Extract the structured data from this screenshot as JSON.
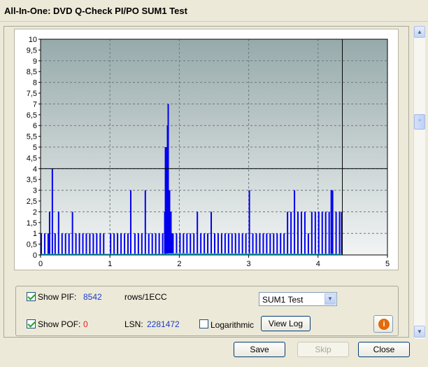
{
  "window": {
    "title": "All-In-One: DVD Q-Check PI/PO SUM1 Test"
  },
  "chart_data": {
    "type": "bar",
    "xlabel": "",
    "ylabel": "",
    "xlim": [
      0,
      5
    ],
    "ylim": [
      0,
      10
    ],
    "x_ticks": [
      "0",
      "1",
      "2",
      "3",
      "4",
      "5"
    ],
    "y_ticks": [
      "0",
      "0,5",
      "1",
      "1,5",
      "2",
      "2,5",
      "3",
      "3,5",
      "4",
      "4,5",
      "5",
      "5,5",
      "6",
      "6,5",
      "7",
      "7,5",
      "8",
      "8,5",
      "9",
      "9,5",
      "10"
    ],
    "threshold_y": 4,
    "end_marker_x": 4.35,
    "colors": {
      "pif": "#0000ee",
      "pof": "#00c8d8",
      "threshold": "#000000"
    },
    "series": [
      {
        "name": "PIF",
        "points": [
          [
            0.0,
            1
          ],
          [
            0.05,
            1
          ],
          [
            0.1,
            1
          ],
          [
            0.12,
            2
          ],
          [
            0.16,
            4
          ],
          [
            0.2,
            1
          ],
          [
            0.25,
            2
          ],
          [
            0.3,
            1
          ],
          [
            0.35,
            1
          ],
          [
            0.4,
            1
          ],
          [
            0.45,
            2
          ],
          [
            0.5,
            1
          ],
          [
            0.55,
            1
          ],
          [
            0.6,
            1
          ],
          [
            0.65,
            1
          ],
          [
            0.7,
            1
          ],
          [
            0.75,
            1
          ],
          [
            0.8,
            1
          ],
          [
            0.85,
            1
          ],
          [
            0.9,
            1
          ],
          [
            1.0,
            1
          ],
          [
            1.05,
            1
          ],
          [
            1.1,
            1
          ],
          [
            1.15,
            1
          ],
          [
            1.2,
            1
          ],
          [
            1.25,
            1
          ],
          [
            1.29,
            3
          ],
          [
            1.35,
            1
          ],
          [
            1.4,
            1
          ],
          [
            1.45,
            1
          ],
          [
            1.5,
            3
          ],
          [
            1.55,
            1
          ],
          [
            1.6,
            1
          ],
          [
            1.65,
            1
          ],
          [
            1.7,
            1
          ],
          [
            1.75,
            1
          ],
          [
            1.78,
            2
          ],
          [
            1.79,
            5
          ],
          [
            1.8,
            5
          ],
          [
            1.81,
            4
          ],
          [
            1.82,
            6
          ],
          [
            1.83,
            7
          ],
          [
            1.84,
            3
          ],
          [
            1.85,
            3
          ],
          [
            1.86,
            2
          ],
          [
            1.87,
            2
          ],
          [
            1.88,
            1
          ],
          [
            1.9,
            1
          ],
          [
            1.95,
            1
          ],
          [
            2.0,
            1
          ],
          [
            2.05,
            1
          ],
          [
            2.1,
            1
          ],
          [
            2.15,
            1
          ],
          [
            2.2,
            1
          ],
          [
            2.25,
            2
          ],
          [
            2.3,
            1
          ],
          [
            2.35,
            1
          ],
          [
            2.4,
            1
          ],
          [
            2.45,
            2
          ],
          [
            2.5,
            1
          ],
          [
            2.55,
            1
          ],
          [
            2.6,
            1
          ],
          [
            2.65,
            1
          ],
          [
            2.7,
            1
          ],
          [
            2.75,
            1
          ],
          [
            2.8,
            1
          ],
          [
            2.85,
            1
          ],
          [
            2.9,
            1
          ],
          [
            2.95,
            1
          ],
          [
            3.0,
            3
          ],
          [
            3.05,
            1
          ],
          [
            3.1,
            1
          ],
          [
            3.15,
            1
          ],
          [
            3.2,
            1
          ],
          [
            3.25,
            1
          ],
          [
            3.3,
            1
          ],
          [
            3.35,
            1
          ],
          [
            3.4,
            1
          ],
          [
            3.45,
            1
          ],
          [
            3.5,
            1
          ],
          [
            3.55,
            2
          ],
          [
            3.6,
            2
          ],
          [
            3.65,
            3
          ],
          [
            3.7,
            2
          ],
          [
            3.75,
            2
          ],
          [
            3.8,
            2
          ],
          [
            3.85,
            1
          ],
          [
            3.9,
            2
          ],
          [
            3.95,
            2
          ],
          [
            4.0,
            2
          ],
          [
            4.05,
            2
          ],
          [
            4.1,
            2
          ],
          [
            4.15,
            2
          ],
          [
            4.18,
            3
          ],
          [
            4.2,
            3
          ],
          [
            4.25,
            2
          ],
          [
            4.3,
            2
          ],
          [
            4.33,
            2
          ]
        ]
      },
      {
        "name": "POF",
        "points": [
          [
            0.0,
            0.02
          ],
          [
            1.8,
            0.02
          ],
          [
            1.85,
            0.05
          ],
          [
            4.35,
            0.02
          ]
        ]
      }
    ]
  },
  "controls": {
    "show_pif_label": "Show PIF:",
    "pif_value": "8542",
    "pif_unit": "rows/1ECC",
    "show_pof_label": "Show POF:",
    "pof_value": "0",
    "lsn_label": "LSN:",
    "lsn_value": "2281472",
    "logarithmic_label": "Logarithmic",
    "view_log_label": "View Log",
    "test_select_value": "SUM1 Test",
    "show_pif_checked": true,
    "show_pof_checked": true,
    "logarithmic_checked": false
  },
  "buttons": {
    "save": "Save",
    "skip": "Skip",
    "close": "Close"
  }
}
